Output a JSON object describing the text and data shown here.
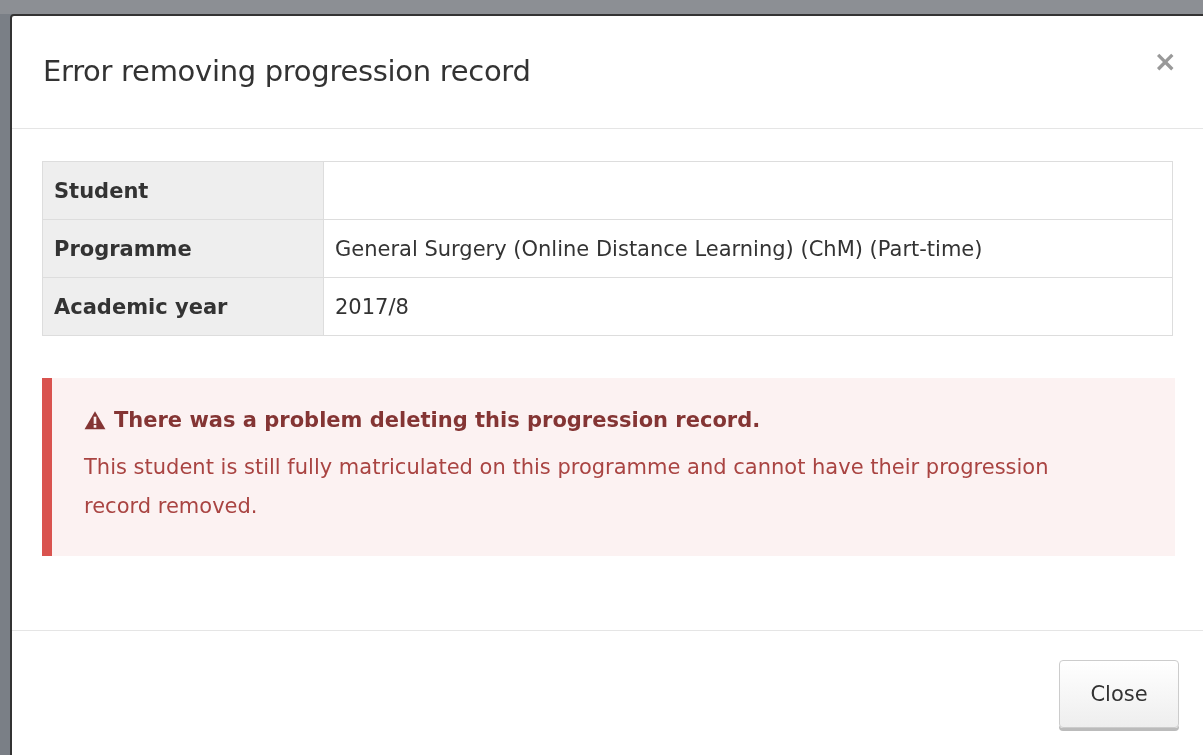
{
  "dialog": {
    "title": "Error removing progression record",
    "close_symbol": "×",
    "details": [
      {
        "label": "Student"
      },
      {
        "label": "Programme",
        "value": "General Surgery (Online Distance Learning) (ChM) (Part-time)"
      },
      {
        "label": "Academic year",
        "value": "2017/8"
      }
    ],
    "alert": {
      "kind": "danger",
      "heading": "There was a problem deleting this progression record.",
      "message": "This student is still fully matriculated on this programme and cannot have their progression record removed."
    },
    "buttons": [
      {
        "label": "Close"
      }
    ]
  }
}
